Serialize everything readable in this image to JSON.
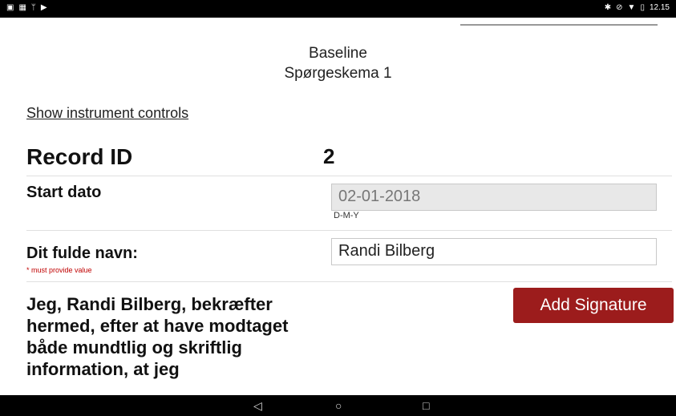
{
  "status_bar": {
    "left_icons": [
      "notification-icon",
      "image-icon",
      "usb-icon",
      "play-store-icon"
    ],
    "right_icons": [
      "bluetooth-icon",
      "alarm-icon",
      "wifi-icon",
      "battery-icon"
    ],
    "time": "12.15"
  },
  "header": {
    "line1": "Baseline",
    "line2": "Spørgeskema 1"
  },
  "controls": {
    "show_label": "Show instrument controls"
  },
  "record": {
    "label": "Record ID",
    "value": "2"
  },
  "start_date": {
    "label": "Start dato",
    "value": "02-01-2018",
    "format": "D-M-Y"
  },
  "full_name": {
    "label": "Dit fulde navn:",
    "required_note": "* must provide value",
    "value": "Randi Bilberg"
  },
  "consent": {
    "text": "Jeg, Randi Bilberg, bekræfter hermed, efter at have modtaget både mundtlig og skriftlig information, at jeg",
    "signature_button": "Add Signature"
  },
  "nav_bar": {
    "back": "◁",
    "home": "○",
    "recents": "□"
  },
  "colors": {
    "button_bg": "#9c1c1c",
    "required_text": "#c00000",
    "readonly_bg": "#e8e8e8"
  }
}
